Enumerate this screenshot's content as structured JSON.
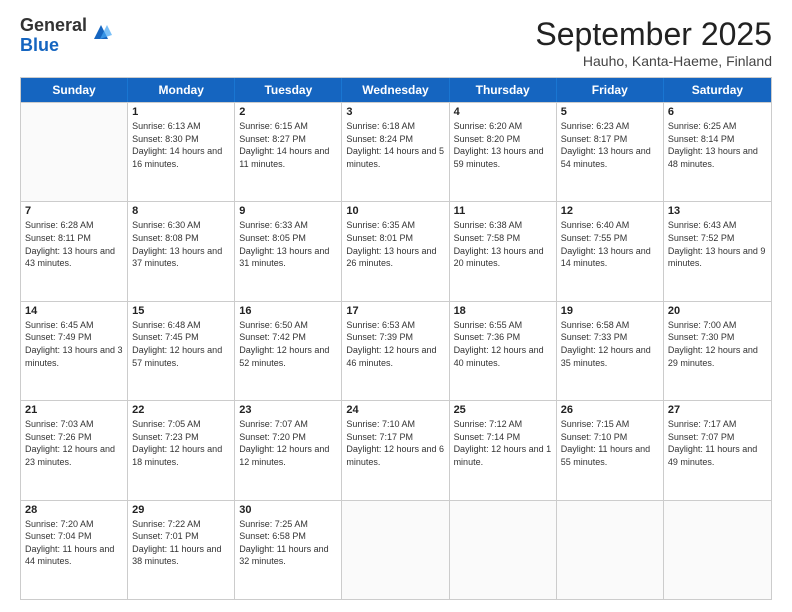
{
  "header": {
    "logo_general": "General",
    "logo_blue": "Blue",
    "title": "September 2025",
    "subtitle": "Hauho, Kanta-Haeme, Finland"
  },
  "days": [
    "Sunday",
    "Monday",
    "Tuesday",
    "Wednesday",
    "Thursday",
    "Friday",
    "Saturday"
  ],
  "weeks": [
    [
      {
        "day": "",
        "empty": true
      },
      {
        "day": "1",
        "sunrise": "6:13 AM",
        "sunset": "8:30 PM",
        "daylight": "14 hours and 16 minutes."
      },
      {
        "day": "2",
        "sunrise": "6:15 AM",
        "sunset": "8:27 PM",
        "daylight": "14 hours and 11 minutes."
      },
      {
        "day": "3",
        "sunrise": "6:18 AM",
        "sunset": "8:24 PM",
        "daylight": "14 hours and 5 minutes."
      },
      {
        "day": "4",
        "sunrise": "6:20 AM",
        "sunset": "8:20 PM",
        "daylight": "13 hours and 59 minutes."
      },
      {
        "day": "5",
        "sunrise": "6:23 AM",
        "sunset": "8:17 PM",
        "daylight": "13 hours and 54 minutes."
      },
      {
        "day": "6",
        "sunrise": "6:25 AM",
        "sunset": "8:14 PM",
        "daylight": "13 hours and 48 minutes."
      }
    ],
    [
      {
        "day": "7",
        "sunrise": "6:28 AM",
        "sunset": "8:11 PM",
        "daylight": "13 hours and 43 minutes."
      },
      {
        "day": "8",
        "sunrise": "6:30 AM",
        "sunset": "8:08 PM",
        "daylight": "13 hours and 37 minutes."
      },
      {
        "day": "9",
        "sunrise": "6:33 AM",
        "sunset": "8:05 PM",
        "daylight": "13 hours and 31 minutes."
      },
      {
        "day": "10",
        "sunrise": "6:35 AM",
        "sunset": "8:01 PM",
        "daylight": "13 hours and 26 minutes."
      },
      {
        "day": "11",
        "sunrise": "6:38 AM",
        "sunset": "7:58 PM",
        "daylight": "13 hours and 20 minutes."
      },
      {
        "day": "12",
        "sunrise": "6:40 AM",
        "sunset": "7:55 PM",
        "daylight": "13 hours and 14 minutes."
      },
      {
        "day": "13",
        "sunrise": "6:43 AM",
        "sunset": "7:52 PM",
        "daylight": "13 hours and 9 minutes."
      }
    ],
    [
      {
        "day": "14",
        "sunrise": "6:45 AM",
        "sunset": "7:49 PM",
        "daylight": "13 hours and 3 minutes."
      },
      {
        "day": "15",
        "sunrise": "6:48 AM",
        "sunset": "7:45 PM",
        "daylight": "12 hours and 57 minutes."
      },
      {
        "day": "16",
        "sunrise": "6:50 AM",
        "sunset": "7:42 PM",
        "daylight": "12 hours and 52 minutes."
      },
      {
        "day": "17",
        "sunrise": "6:53 AM",
        "sunset": "7:39 PM",
        "daylight": "12 hours and 46 minutes."
      },
      {
        "day": "18",
        "sunrise": "6:55 AM",
        "sunset": "7:36 PM",
        "daylight": "12 hours and 40 minutes."
      },
      {
        "day": "19",
        "sunrise": "6:58 AM",
        "sunset": "7:33 PM",
        "daylight": "12 hours and 35 minutes."
      },
      {
        "day": "20",
        "sunrise": "7:00 AM",
        "sunset": "7:30 PM",
        "daylight": "12 hours and 29 minutes."
      }
    ],
    [
      {
        "day": "21",
        "sunrise": "7:03 AM",
        "sunset": "7:26 PM",
        "daylight": "12 hours and 23 minutes."
      },
      {
        "day": "22",
        "sunrise": "7:05 AM",
        "sunset": "7:23 PM",
        "daylight": "12 hours and 18 minutes."
      },
      {
        "day": "23",
        "sunrise": "7:07 AM",
        "sunset": "7:20 PM",
        "daylight": "12 hours and 12 minutes."
      },
      {
        "day": "24",
        "sunrise": "7:10 AM",
        "sunset": "7:17 PM",
        "daylight": "12 hours and 6 minutes."
      },
      {
        "day": "25",
        "sunrise": "7:12 AM",
        "sunset": "7:14 PM",
        "daylight": "12 hours and 1 minute."
      },
      {
        "day": "26",
        "sunrise": "7:15 AM",
        "sunset": "7:10 PM",
        "daylight": "11 hours and 55 minutes."
      },
      {
        "day": "27",
        "sunrise": "7:17 AM",
        "sunset": "7:07 PM",
        "daylight": "11 hours and 49 minutes."
      }
    ],
    [
      {
        "day": "28",
        "sunrise": "7:20 AM",
        "sunset": "7:04 PM",
        "daylight": "11 hours and 44 minutes."
      },
      {
        "day": "29",
        "sunrise": "7:22 AM",
        "sunset": "7:01 PM",
        "daylight": "11 hours and 38 minutes."
      },
      {
        "day": "30",
        "sunrise": "7:25 AM",
        "sunset": "6:58 PM",
        "daylight": "11 hours and 32 minutes."
      },
      {
        "day": "",
        "empty": true
      },
      {
        "day": "",
        "empty": true
      },
      {
        "day": "",
        "empty": true
      },
      {
        "day": "",
        "empty": true
      }
    ]
  ]
}
